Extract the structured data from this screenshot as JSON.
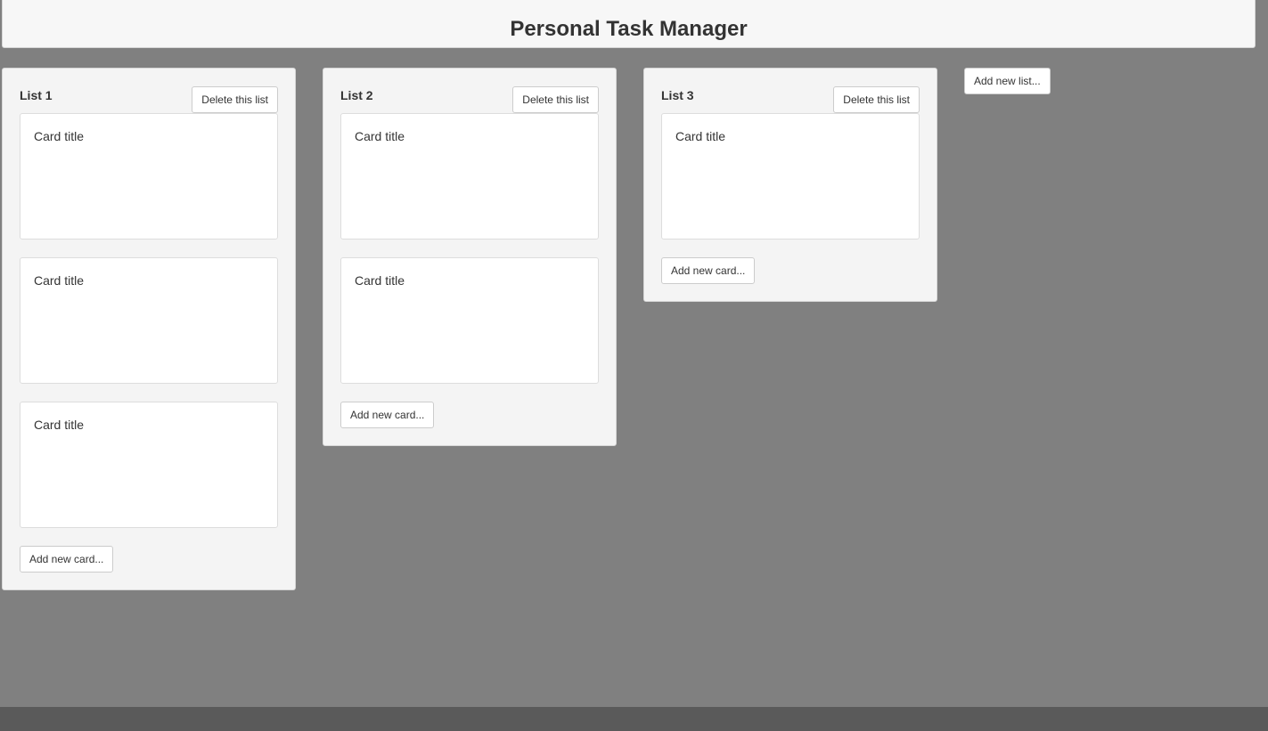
{
  "app": {
    "title": "Personal Task Manager"
  },
  "lists": [
    {
      "title": "List 1",
      "delete_label": "Delete this list",
      "cards": [
        {
          "title": "Card title"
        },
        {
          "title": "Card title"
        },
        {
          "title": "Card title"
        }
      ],
      "add_card_label": "Add new card..."
    },
    {
      "title": "List 2",
      "delete_label": "Delete this list",
      "cards": [
        {
          "title": "Card title"
        },
        {
          "title": "Card title"
        }
      ],
      "add_card_label": "Add new card..."
    },
    {
      "title": "List 3",
      "delete_label": "Delete this list",
      "cards": [
        {
          "title": "Card title"
        }
      ],
      "add_card_label": "Add new card..."
    }
  ],
  "add_list_label": "Add new list...",
  "colors": {
    "background": "#808080",
    "header_bg": "#f7f7f7",
    "list_bg": "#f4f4f4",
    "card_bg": "#ffffff",
    "footer_bg": "#5a5a5a",
    "text": "#333333"
  }
}
